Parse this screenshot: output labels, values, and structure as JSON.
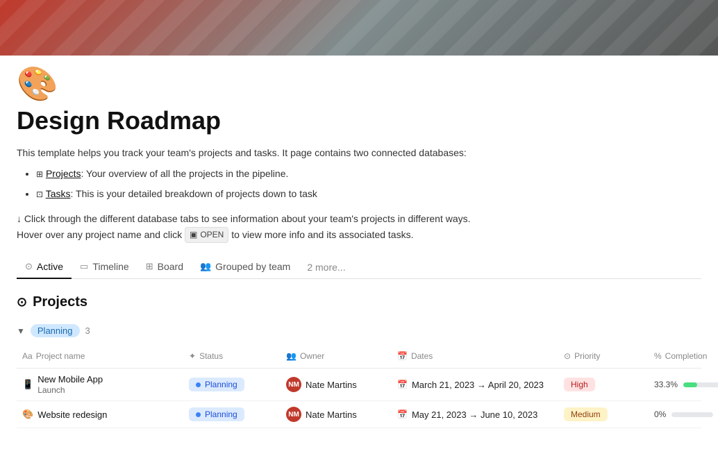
{
  "header": {
    "icon": "🎨",
    "title": "Design Roadmap",
    "description": "This template helps you track your team's projects and tasks. It page contains two connected databases:",
    "items": [
      {
        "label": "Projects",
        "description": ": Your overview of all the projects in the pipeline."
      },
      {
        "label": "Tasks",
        "description": ": This is your detailed breakdown of projects down to task"
      }
    ],
    "instructions_1": "↓ Click through the different database tabs to see information about your team's projects in different ways.",
    "instructions_2": "Hover over any project name and click",
    "open_button": "OPEN",
    "instructions_3": "to view more info and its associated tasks."
  },
  "tabs": [
    {
      "id": "active",
      "label": "Active",
      "icon": "⊙",
      "active": true
    },
    {
      "id": "timeline",
      "label": "Timeline",
      "icon": "▭"
    },
    {
      "id": "board",
      "label": "Board",
      "icon": "⊞"
    },
    {
      "id": "grouped",
      "label": "Grouped by team",
      "icon": "👥"
    }
  ],
  "more_tabs_label": "2 more...",
  "section": {
    "title": "Projects",
    "icon": "⊙"
  },
  "group": {
    "toggle": "▼",
    "label": "Planning",
    "count": "3"
  },
  "table": {
    "columns": [
      {
        "id": "name",
        "label": "Project name",
        "icon": "Aa"
      },
      {
        "id": "status",
        "label": "Status",
        "icon": "✦"
      },
      {
        "id": "owner",
        "label": "Owner",
        "icon": "👥"
      },
      {
        "id": "dates",
        "label": "Dates",
        "icon": "📅"
      },
      {
        "id": "priority",
        "label": "Priority",
        "icon": "⊙"
      },
      {
        "id": "completion",
        "label": "Completion",
        "icon": "%"
      }
    ],
    "rows": [
      {
        "name": "New Mobile App",
        "name_sub": "Launch",
        "icon": "📱",
        "status": "Planning",
        "owner_name": "Nate Martins",
        "owner_initials": "NM",
        "dates": "March 21, 2023 → April 20, 2023",
        "priority": "High",
        "priority_type": "high",
        "completion_pct": "33.3%",
        "completion_val": 33.3
      },
      {
        "name": "Website redesign",
        "name_sub": "",
        "icon": "🎨",
        "status": "Planning",
        "owner_name": "Nate Martins",
        "owner_initials": "NM",
        "dates": "May 21, 2023 → June 10, 2023",
        "priority": "Medium",
        "priority_type": "medium",
        "completion_pct": "0%",
        "completion_val": 0
      }
    ]
  },
  "colors": {
    "accent": "#111111",
    "planning_bg": "#dbeafe",
    "planning_text": "#1d4ed8",
    "high_bg": "#fee2e2",
    "high_text": "#b91c1c",
    "medium_bg": "#fef3c7",
    "medium_text": "#92400e",
    "progress_color": "#4ade80"
  }
}
